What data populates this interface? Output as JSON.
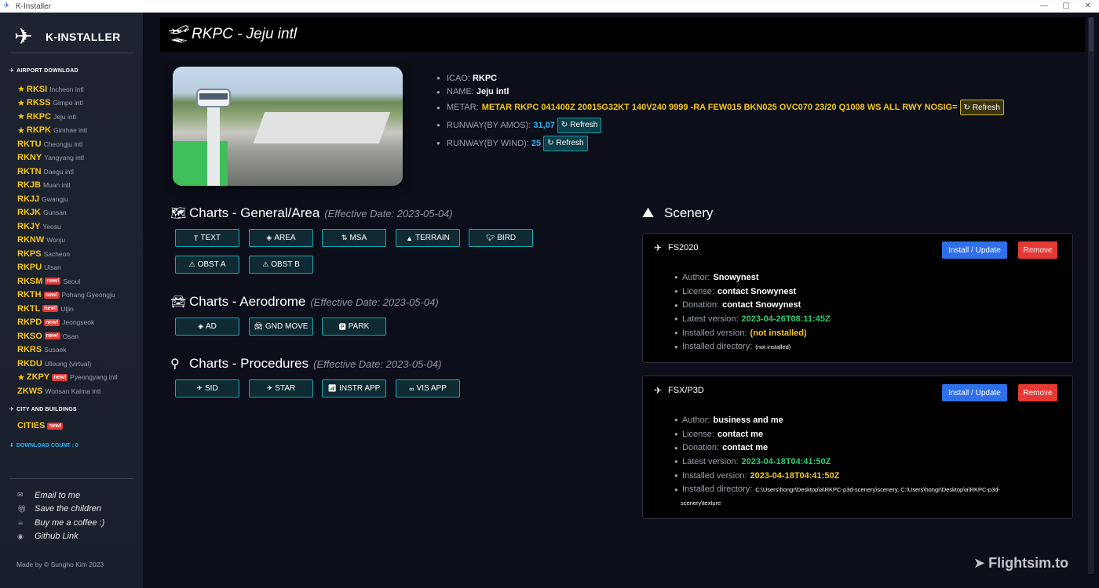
{
  "window": {
    "title": "K-Installer",
    "minimize_icon": "—",
    "maximize_icon": "▢",
    "close_icon": "✕"
  },
  "sidebar": {
    "brand": "K-INSTALLER",
    "section_airport": "AIRPORT DOWNLOAD",
    "airports": [
      {
        "code": "RKSI",
        "name": "Incheon intl",
        "starred": true,
        "new": false
      },
      {
        "code": "RKSS",
        "name": "Gimpo intl",
        "starred": true,
        "new": false
      },
      {
        "code": "RKPC",
        "name": "Jeju intl",
        "starred": true,
        "new": false
      },
      {
        "code": "RKPK",
        "name": "Gimhae intl",
        "starred": true,
        "new": false
      },
      {
        "code": "RKTU",
        "name": "Cheongju intl",
        "starred": false,
        "new": false
      },
      {
        "code": "RKNY",
        "name": "Yangyang intl",
        "starred": false,
        "new": false
      },
      {
        "code": "RKTN",
        "name": "Daegu intl",
        "starred": false,
        "new": false
      },
      {
        "code": "RKJB",
        "name": "Muan intl",
        "starred": false,
        "new": false
      },
      {
        "code": "RKJJ",
        "name": "Gwangju",
        "starred": false,
        "new": false
      },
      {
        "code": "RKJK",
        "name": "Gunsan",
        "starred": false,
        "new": false
      },
      {
        "code": "RKJY",
        "name": "Yeosu",
        "starred": false,
        "new": false
      },
      {
        "code": "RKNW",
        "name": "Wonju",
        "starred": false,
        "new": false
      },
      {
        "code": "RKPS",
        "name": "Sacheon",
        "starred": false,
        "new": false
      },
      {
        "code": "RKPU",
        "name": "Ulsan",
        "starred": false,
        "new": false
      },
      {
        "code": "RKSM",
        "name": "Seoul",
        "starred": false,
        "new": true
      },
      {
        "code": "RKTH",
        "name": "Pohang Gyeongju",
        "starred": false,
        "new": true
      },
      {
        "code": "RKTL",
        "name": "Uljin",
        "starred": false,
        "new": true
      },
      {
        "code": "RKPD",
        "name": "Jeongseok",
        "starred": false,
        "new": true
      },
      {
        "code": "RKSO",
        "name": "Osan",
        "starred": false,
        "new": true
      },
      {
        "code": "RKRS",
        "name": "Susaek",
        "starred": false,
        "new": false
      },
      {
        "code": "RKDU",
        "name": "Ulleung (virtual)",
        "starred": false,
        "new": false
      },
      {
        "code": "ZKPY",
        "name": "Pyeongyang intl",
        "starred": true,
        "new": true
      },
      {
        "code": "ZKWS",
        "name": "Wonsan Kalma intl",
        "starred": false,
        "new": false
      }
    ],
    "new_badge": "new!",
    "section_city": "CITY AND BUILDINGS",
    "cities_label": "CITIES",
    "download_count": "DOWNLOAD COUNT : 0",
    "links": [
      {
        "label": "Email to me",
        "icon": "email-icon"
      },
      {
        "label": "Save the children",
        "icon": "gift-icon"
      },
      {
        "label": "Buy me a coffee :)",
        "icon": "coffee-icon"
      },
      {
        "label": "Github Link",
        "icon": "github-icon"
      }
    ],
    "made_by": "Made by © Sungho Kim 2023"
  },
  "header": {
    "title": "RKPC - Jeju intl"
  },
  "info": {
    "icao_label": "ICAO:",
    "icao_value": "RKPC",
    "name_label": "NAME:",
    "name_value": "Jeju intl",
    "metar_label": "METAR:",
    "metar_value": "METAR RKPC 041400Z 20015G32KT 140V240 9999 -RA FEW015 BKN025 OVC070 23/20 Q1008 WS ALL RWY NOSIG=",
    "runway_amos_label": "RUNWAY(BY AMOS):",
    "runway_amos_value": "31,07",
    "runway_wind_label": "RUNWAY(BY WIND):",
    "runway_wind_value": "25",
    "refresh_label": "Refresh"
  },
  "charts": {
    "general": {
      "title": "Charts - General/Area",
      "effective": "(Effective Date: 2023-05-04)",
      "buttons": [
        "TEXT",
        "AREA",
        "MSA",
        "TERRAIN",
        "BIRD",
        "OBST A",
        "OBST B"
      ]
    },
    "aerodrome": {
      "title": "Charts - Aerodrome",
      "effective": "(Effective Date: 2023-05-04)",
      "buttons": [
        "AD",
        "GND MOVE",
        "PARK"
      ]
    },
    "procedures": {
      "title": "Charts - Procedures",
      "effective": "(Effective Date: 2023-05-04)",
      "buttons": [
        "SID",
        "STAR",
        "INSTR APP",
        "VIS APP"
      ]
    }
  },
  "scenery": {
    "title": "Scenery",
    "install_label": "Install / Update",
    "remove_label": "Remove",
    "labels": {
      "author": "Author:",
      "license": "License:",
      "donation": "Donation:",
      "latest": "Latest version:",
      "installed": "Installed version:",
      "directory": "Installed directory:"
    },
    "cards": [
      {
        "name": "FS2020",
        "author": "Snowynest",
        "license": "contact Snowynest",
        "donation": "contact Snowynest",
        "latest": "2023-04-26T08:11:45Z",
        "installed": "(not installed)",
        "directory": "(not installed)"
      },
      {
        "name": "FSX/P3D",
        "author": "business and me",
        "license": "contact me",
        "donation": "contact me",
        "latest": "2023-04-18T04:41:50Z",
        "installed": "2023-04-18T04:41:50Z",
        "directory_line1": "C:\\Users\\hongr\\Desktop\\a\\RKPC-p3d-scenery\\scenery, C:\\Users\\hongr\\Desktop\\a\\RKPC-p3d-",
        "directory_line2": "scenery\\texture"
      }
    ]
  },
  "watermark": "Flightsim.to",
  "colors": {
    "accent_yellow": "#f5c518",
    "accent_blue": "#29b6f6",
    "install_blue": "#2f6fea",
    "remove_red": "#e53935",
    "version_green": "#2ecc71",
    "chart_button_border": "#1aa7b4"
  }
}
